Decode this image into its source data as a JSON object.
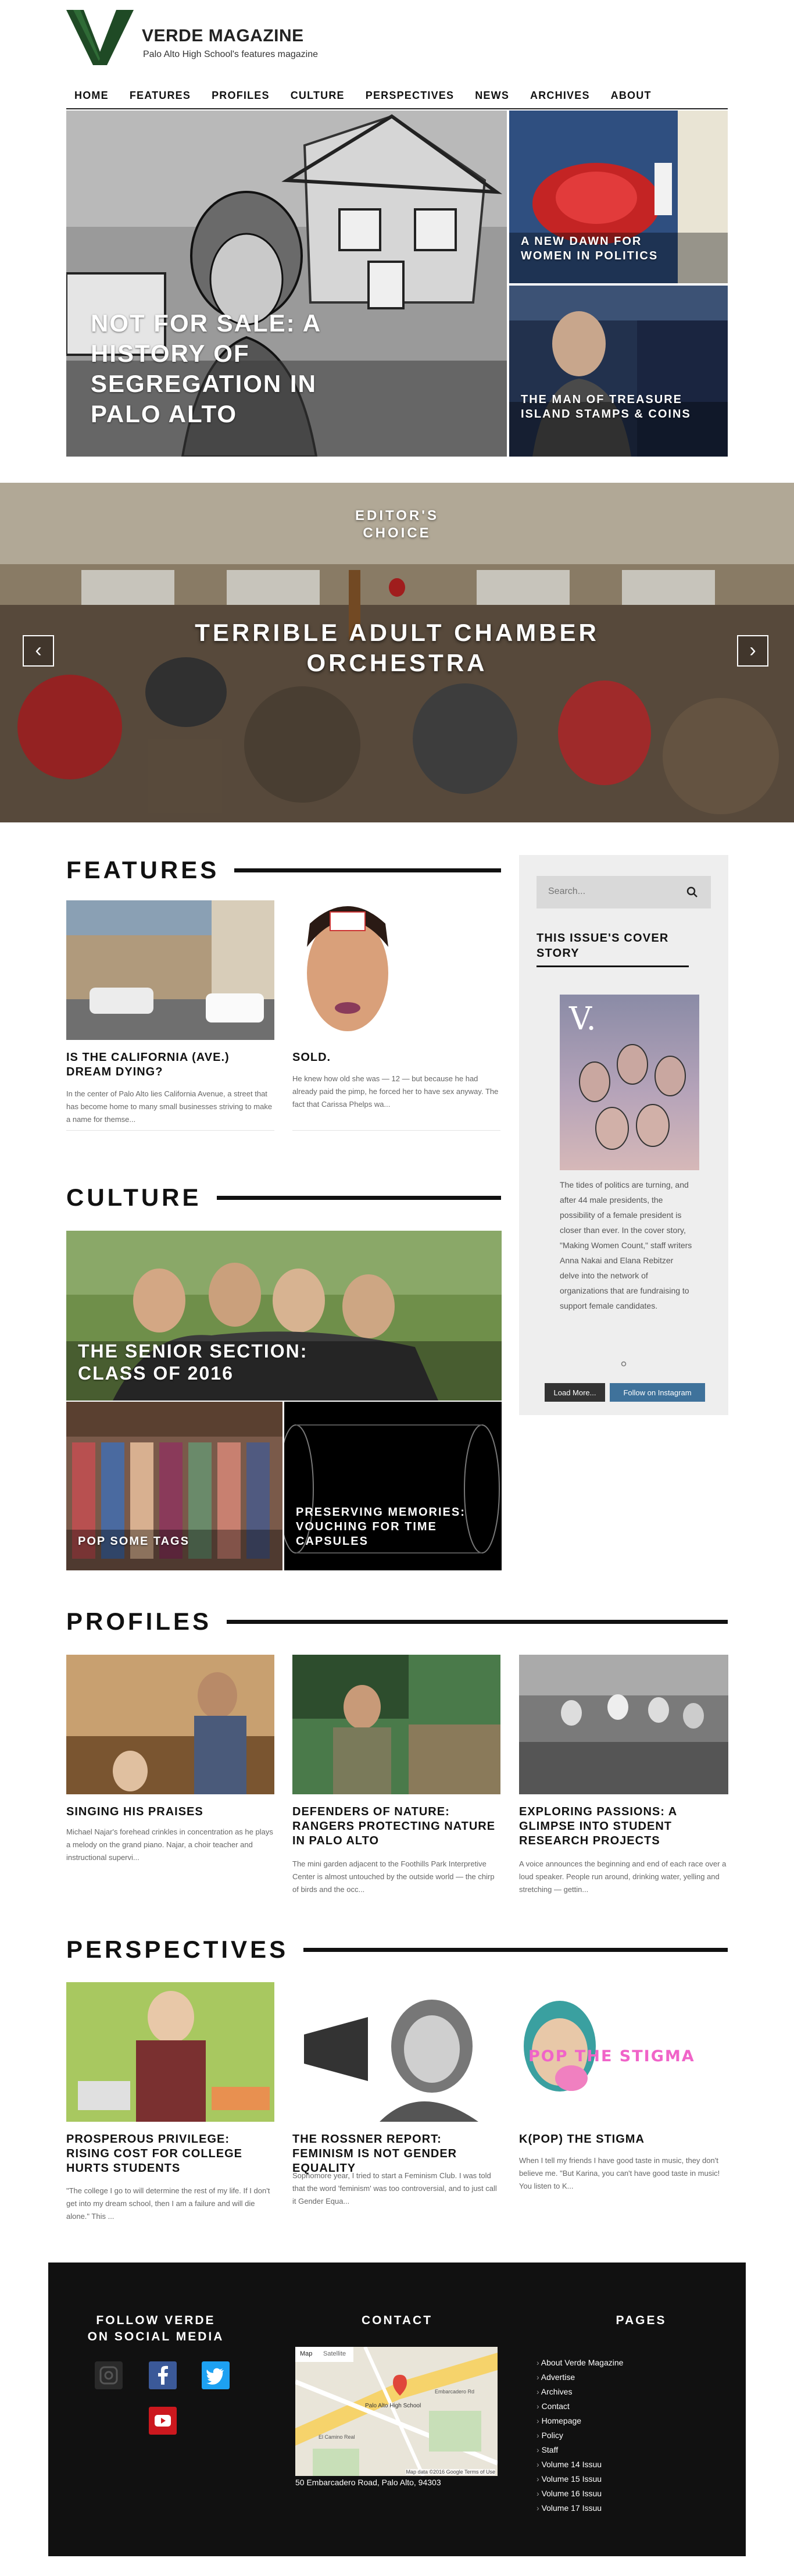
{
  "brand": {
    "logo_letter": "V",
    "title": "VERDE MAGAZINE",
    "subtitle": "Palo Alto High School's features magazine",
    "accent_color": "#1f4a25"
  },
  "nav": [
    "HOME",
    "FEATURES",
    "PROFILES",
    "CULTURE",
    "PERSPECTIVES",
    "NEWS",
    "ARCHIVES",
    "ABOUT"
  ],
  "hero": {
    "main": "NOT FOR SALE: A HISTORY OF SEGREGATION IN PALO ALTO",
    "top_right": "A NEW DAWN FOR WOMEN IN POLITICS",
    "bottom_right": "THE MAN OF TREASURE ISLAND STAMPS & COINS"
  },
  "editors_choice": {
    "label": "EDITOR'S CHOICE",
    "title": "TERRIBLE ADULT CHAMBER ORCHESTRA",
    "prev": "‹",
    "next": "›"
  },
  "features": {
    "heading": "FEATURES",
    "items": [
      {
        "title": "IS THE CALIFORNIA (AVE.) DREAM DYING?",
        "excerpt": "In the center of Palo Alto lies California Avenue, a street that has become home to many small businesses striving to make a name for themse..."
      },
      {
        "title": "SOLD.",
        "excerpt": "He knew how old she was — 12 — but because he had already paid the pimp, he forced her to have sex anyway. The fact that Carissa Phelps wa..."
      }
    ]
  },
  "sidebar": {
    "search_placeholder": "Search...",
    "cover_heading": "THIS ISSUE'S COVER STORY",
    "cover_letter": "V.",
    "cover_text": "The tides of politics are turning, and after 44 male presidents, the possibility of a female president is closer than ever. In the cover story, \"Making Women Count,\" staff writers Anna Nakai and Elana Rebitzer delve into the network of organizations that are fundraising to support female candidates.",
    "load_more": "Load More...",
    "follow_instagram": "Follow on Instagram"
  },
  "culture": {
    "heading": "CULTURE",
    "main": "THE SENIOR SECTION: CLASS OF 2016",
    "left": "POP SOME TAGS",
    "right": "PRESERVING MEMORIES: VOUCHING FOR TIME CAPSULES"
  },
  "profiles": {
    "heading": "PROFILES",
    "items": [
      {
        "title": "SINGING HIS PRAISES",
        "excerpt": "Michael Najar's forehead crinkles in concentration as he plays a melody on the grand piano. Najar, a choir teacher and instructional supervi..."
      },
      {
        "title": "DEFENDERS OF NATURE: RANGERS PROTECTING NATURE IN PALO ALTO",
        "excerpt": "The mini garden adjacent to the Foothills Park Interpretive Center is almost untouched by the outside world — the chirp of birds and the occ..."
      },
      {
        "title": "EXPLORING PASSIONS: A GLIMPSE INTO STUDENT RESEARCH PROJECTS",
        "excerpt": "A voice announces the beginning and end of each race over a loud speaker. People run around, drinking water, yelling and stretching — gettin..."
      }
    ]
  },
  "perspectives": {
    "heading": "PERSPECTIVES",
    "items": [
      {
        "title": "PROSPEROUS PRIVILEGE: RISING COST FOR COLLEGE HURTS STUDENTS",
        "excerpt": "\"The college I go to will determine the rest of my life. If I don't get into my dream school, then I am a failure and will die alone.\" This ..."
      },
      {
        "title": "THE ROSSNER REPORT: FEMINISM IS NOT GENDER EQUALITY",
        "excerpt": "Sophomore year, I tried to start a Feminism Club. I was told that the word 'feminism' was too controversial, and to just call it Gender Equa..."
      },
      {
        "title": "K(POP) THE STIGMA",
        "excerpt": "When I tell my friends I have good taste in music, they don't believe me. \"But Karina, you can't have good taste in music! You listen to K..."
      }
    ],
    "kpop_art_text": "POP THE STIGMA"
  },
  "footer": {
    "social_heading": "FOLLOW VERDE ON SOCIAL MEDIA",
    "contact_heading": "CONTACT",
    "pages_heading": "PAGES",
    "address": "50 Embarcadero Road, Palo Alto, 94303",
    "map": {
      "tab_map": "Map",
      "tab_satellite": "Satellite",
      "pin_label": "Palo Alto High School",
      "credit": "Map data ©2016 Google   Terms of Use",
      "street_1": "El Camino Real",
      "street_2": "Embarcadero Rd"
    },
    "pages": [
      "About Verde Magazine",
      "Advertise",
      "Archives",
      "Contact",
      "Homepage",
      "Policy",
      "Staff",
      "Volume 14 Issuu",
      "Volume 15 Issuu",
      "Volume 16 Issuu",
      "Volume 17 Issuu"
    ]
  }
}
